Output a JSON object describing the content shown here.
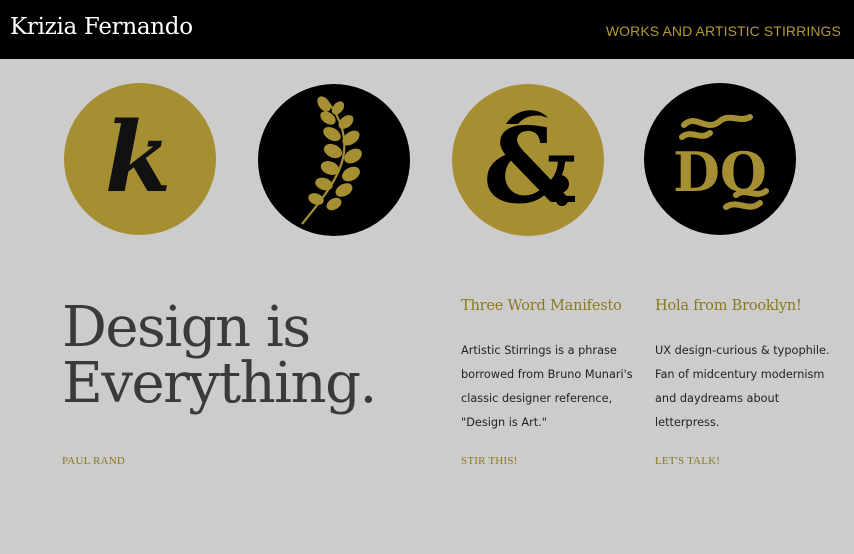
{
  "header": {
    "site_title": "Krizia Fernando",
    "nav_link": "WORKS AND ARTISTIC STIRRINGS"
  },
  "circles": [
    {
      "icon": "letter-k-icon",
      "glyph": "k",
      "background": "#a68f33",
      "glyph_color": "#111111"
    },
    {
      "icon": "fern-sprig-icon",
      "background": "#000000",
      "glyph_color": "#a68f33"
    },
    {
      "icon": "ampersand-icon",
      "glyph": "&",
      "background": "#a68f33",
      "glyph_color": "#000000"
    },
    {
      "icon": "do-lettering-icon",
      "glyph": "DO",
      "background": "#000000",
      "glyph_color": "#a68f33"
    }
  ],
  "hero": {
    "quote_line1": "Design is",
    "quote_line2": "Everything.",
    "author": "PAUL RAND"
  },
  "columns": [
    {
      "heading": "Three Word Manifesto",
      "lines": [
        "Artistic Stirrings is a phrase",
        "borrowed from Bruno Munari's",
        "classic designer reference,",
        "\"Design is Art.\""
      ],
      "link": "STIR THIS!"
    },
    {
      "heading": "Hola from Brooklyn!",
      "lines": [
        "UX design-curious & typophile.",
        "Fan of midcentury modernism",
        "and daydreams about",
        "letterpress."
      ],
      "link": "LET'S TALK!"
    }
  ],
  "colors": {
    "page_background": "#cccccc",
    "header_background": "#000000",
    "accent_gold": "#a68f33",
    "text_gold": "#8a7a1e",
    "headline_gray": "#3a3a3a"
  }
}
